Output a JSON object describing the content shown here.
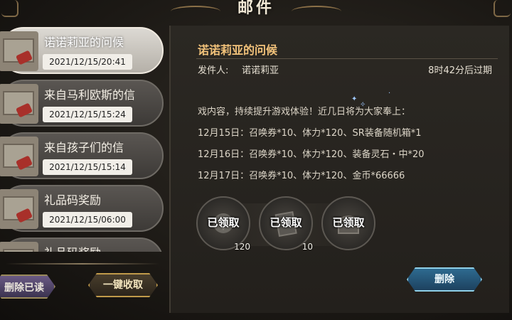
{
  "header": {
    "title": "邮件"
  },
  "mail_list": [
    {
      "title": "诺诺莉亚的问候",
      "date": "2021/12/15/20:41",
      "selected": true
    },
    {
      "title": "来自马利欧斯的信",
      "date": "2021/12/15/15:24",
      "selected": false
    },
    {
      "title": "来自孩子们的信",
      "date": "2021/12/15/15:14",
      "selected": false
    },
    {
      "title": "礼品码奖励",
      "date": "2021/12/15/06:00",
      "selected": false
    },
    {
      "title": "礼品码奖励",
      "date": "",
      "selected": false
    }
  ],
  "buttons": {
    "delete_read": "删除已读",
    "collect_all": "一键收取",
    "delete": "删除"
  },
  "detail": {
    "title": "诺诺莉亚的问候",
    "sender_label": "发件人:",
    "sender": "诺诺莉亚",
    "expire": "8时42分后过期",
    "lines": [
      "戏内容，持续提升游戏体验！近几日将为大家奉上：",
      "12月15日：召唤券*10、体力*120、SR装备随机箱*1",
      "12月16日：召唤券*10、体力*120、装备灵石・中*20",
      "12月17日：召唤券*10、体力*120、金币*66666"
    ]
  },
  "rewards": [
    {
      "icon": "stamina-icon",
      "status": "已领取",
      "qty": "120"
    },
    {
      "icon": "summon-ticket-icon",
      "status": "已领取",
      "qty": "10"
    },
    {
      "icon": "treasure-chest-icon",
      "status": "已领取",
      "qty": ""
    }
  ],
  "colors": {
    "accent_title": "#f2c27a",
    "selected_item": "#dcd9d3",
    "delete_button": "#2f6d93",
    "collect_button_border": "#c09a4a"
  }
}
